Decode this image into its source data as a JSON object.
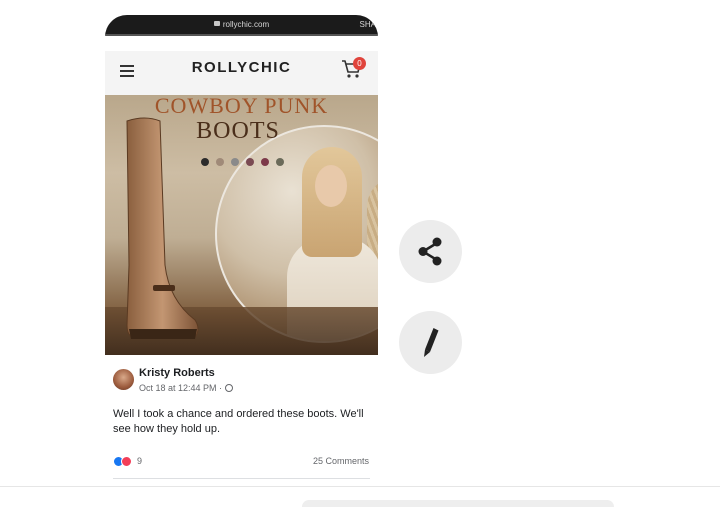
{
  "browser": {
    "url": "rollychic.com",
    "share_label": "SHA"
  },
  "site": {
    "brand": "ROLLYCHIC",
    "cart_count": "0"
  },
  "hero": {
    "title_line1": "COWBOY PUNK",
    "title_line2": "BOOTS",
    "swatch_colors": [
      "#2b2b2b",
      "#a08a78",
      "#8a8a8a",
      "#7a4a52",
      "#7d3a4a",
      "#6b6b5a"
    ]
  },
  "post": {
    "author": "Kristy Roberts",
    "timestamp": "Oct 18 at 12:44 PM",
    "separator": " · ",
    "text": "Well I took a chance and ordered these boots. We'll see how they hold up.",
    "reaction_count": "9",
    "comments": "25 Comments"
  },
  "actions": {
    "share_icon": "share-icon",
    "edit_icon": "pencil-icon"
  },
  "colors": {
    "badge": "#e0443c",
    "like": "#1877f2",
    "love": "#f33e58"
  }
}
